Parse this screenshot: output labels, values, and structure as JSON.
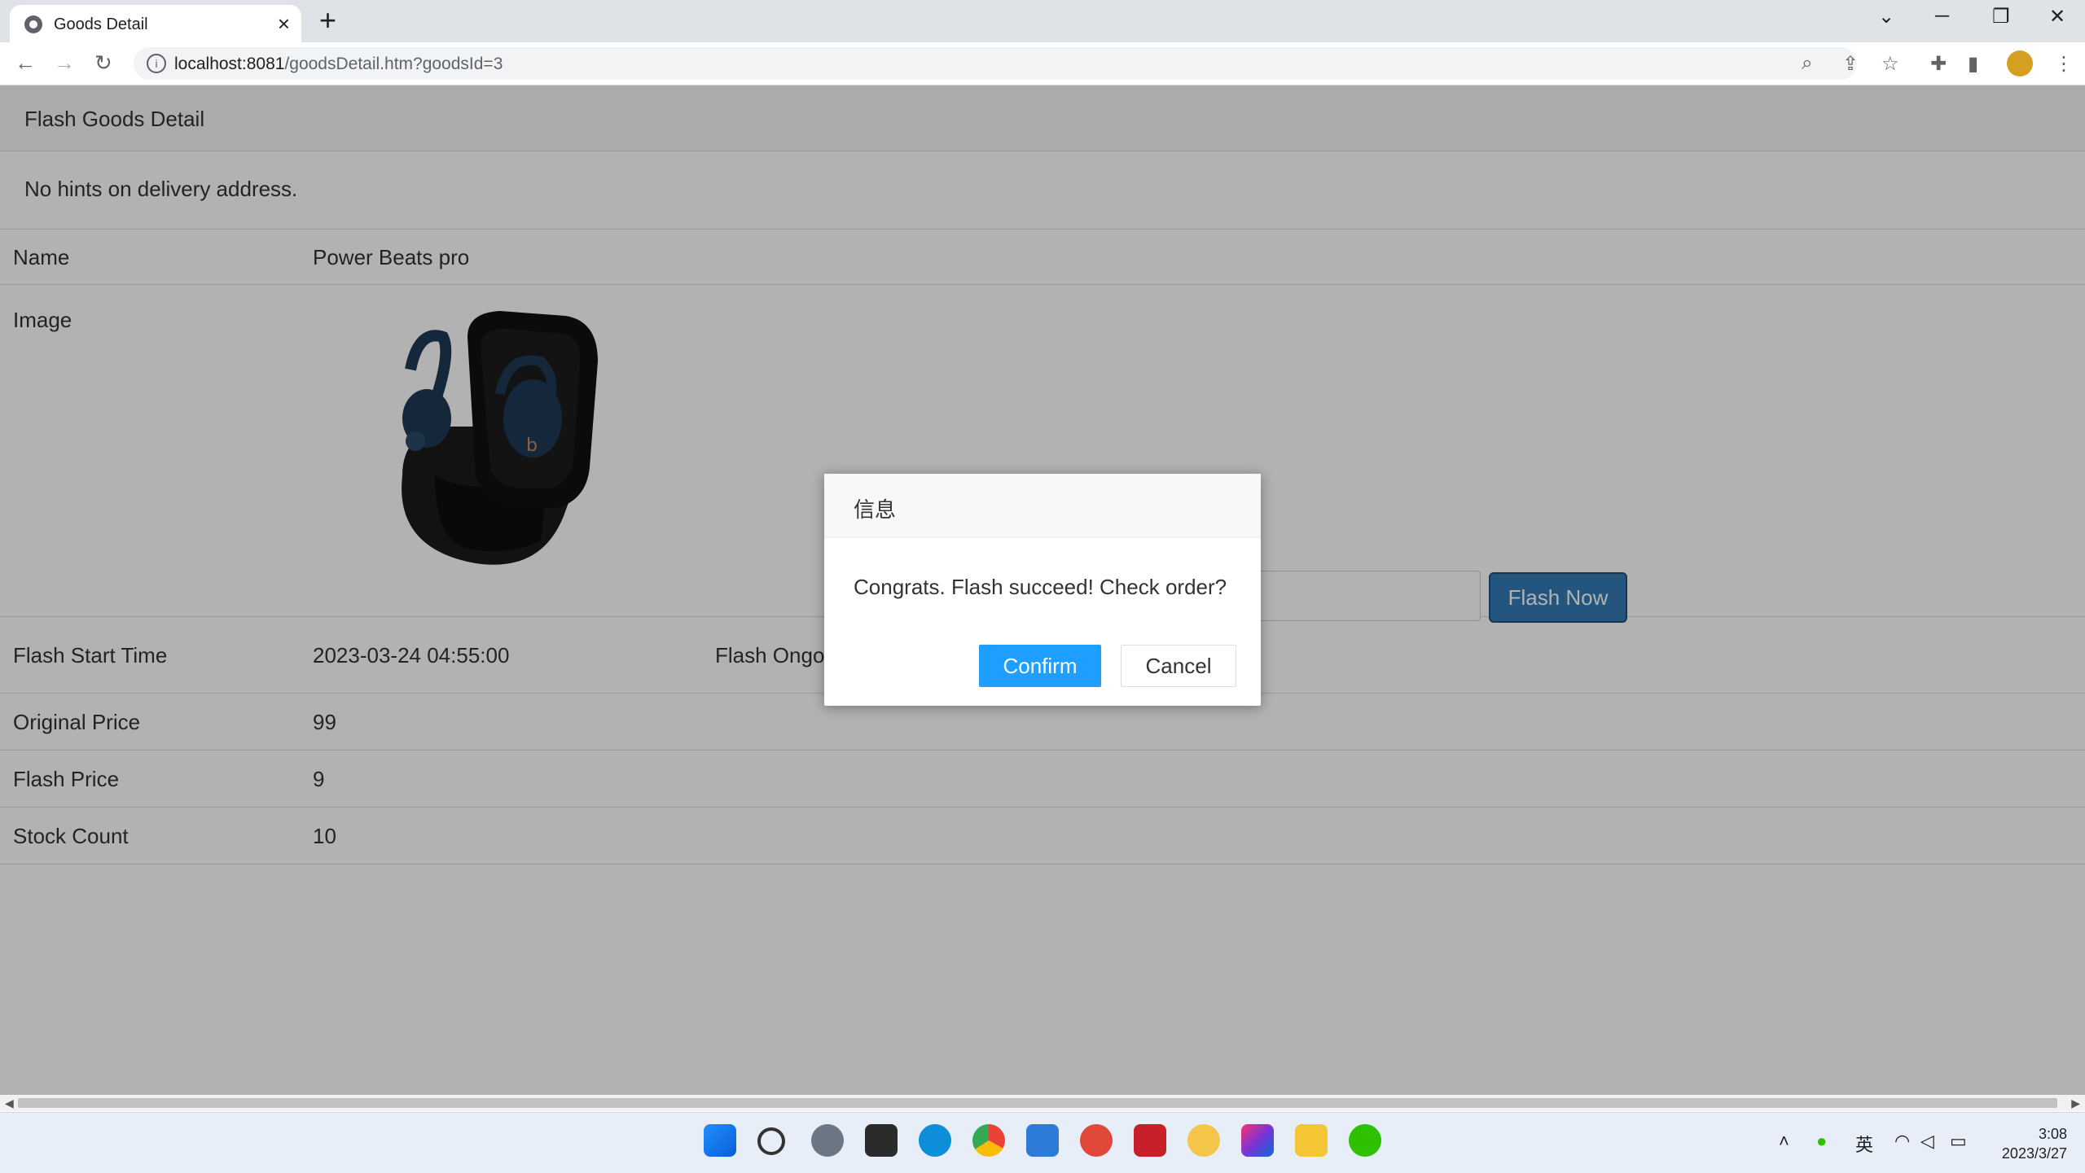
{
  "browser": {
    "tab_title": "Goods Detail",
    "new_tab": "+",
    "url_host": "localhost:8081",
    "url_path": "/goodsDetail.htm?goodsId=3",
    "controls": {
      "minimize": "─",
      "restore": "❐",
      "close": "✕",
      "dropdown": "⌄"
    }
  },
  "page": {
    "panel_title": "Flash Goods Detail",
    "hint": "No hints on delivery address.",
    "rows": {
      "name_label": "Name",
      "name_value": "Power Beats pro",
      "image_label": "Image",
      "start_label": "Flash Start Time",
      "start_value": "2023-03-24 04:55:00",
      "status_text": "Flash Ongo",
      "flash_button": "Flash Now",
      "orig_label": "Original Price",
      "orig_value": "99",
      "flash_price_label": "Flash Price",
      "flash_price_value": "9",
      "stock_label": "Stock Count",
      "stock_value": "10"
    }
  },
  "dialog": {
    "title": "信息",
    "message": "Congrats. Flash succeed! Check order?",
    "confirm": "Confirm",
    "cancel": "Cancel"
  },
  "taskbar": {
    "ime": "英",
    "time": "3:08",
    "date": "2023/3/27",
    "colors": {
      "chrome": "#1a73e8",
      "edge": "#0c8fd8"
    }
  }
}
